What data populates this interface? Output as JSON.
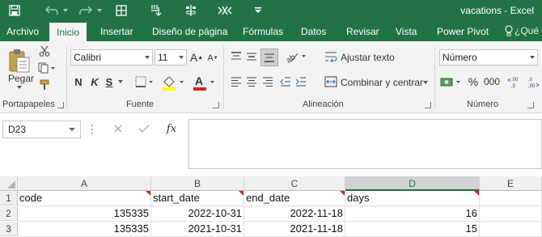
{
  "window": {
    "title": "vacations - Excel"
  },
  "tabs": [
    "Archivo",
    "Inicio",
    "Insertar",
    "Diseño de página",
    "Fórmulas",
    "Datos",
    "Revisar",
    "Vista",
    "Power Pivot"
  ],
  "tell_me": "¿Qué",
  "ribbon": {
    "clipboard": {
      "paste_label": "Pegar",
      "group_label": "Portapapeles"
    },
    "font": {
      "name": "Calibri",
      "size": "11",
      "bold": "N",
      "italic": "K",
      "underline": "S",
      "grow": "A",
      "shrink": "A",
      "group_label": "Fuente"
    },
    "alignment": {
      "wrap_text": "Ajustar texto",
      "merge_center": "Combinar y centrar",
      "group_label": "Alineación"
    },
    "number": {
      "format": "Número",
      "percent": "%",
      "comma": "000",
      "group_label": "Número"
    }
  },
  "formula_bar": {
    "name_box": "D23",
    "fx": "fx",
    "content": ""
  },
  "sheet": {
    "columns": [
      "A",
      "B",
      "C",
      "D",
      "E"
    ],
    "selected_column": "D",
    "rows": [
      {
        "num": "1",
        "cells": [
          "code",
          "start_date",
          "end_date",
          "days",
          ""
        ]
      },
      {
        "num": "2",
        "cells": [
          "135335",
          "2022-10-31",
          "2022-11-18",
          "16",
          ""
        ]
      },
      {
        "num": "3",
        "cells": [
          "135335",
          "2021-10-31",
          "2021-11-18",
          "15",
          ""
        ]
      }
    ]
  },
  "colors": {
    "excel_green": "#217346",
    "comment_marker": "#e0201b",
    "font_color_bar": "#e0201b",
    "highlight_bar": "#ffff00"
  }
}
